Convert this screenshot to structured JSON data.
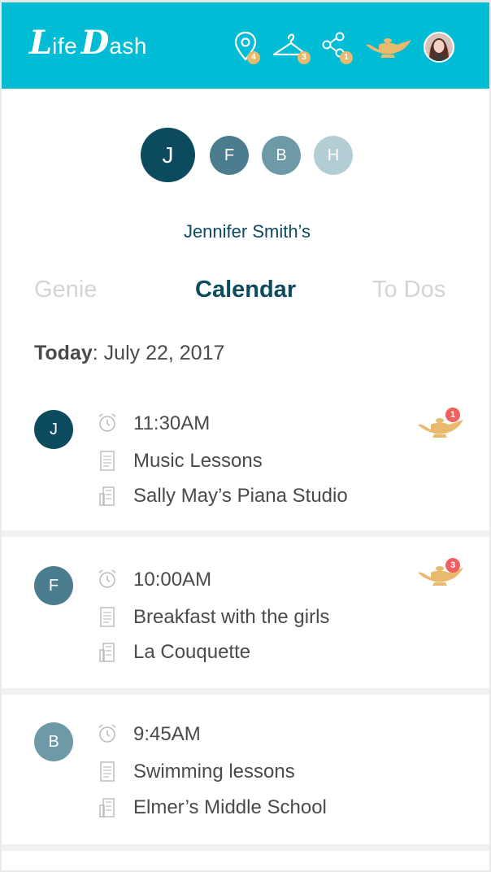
{
  "app": {
    "logo_big_1": "L",
    "logo_small_1": "ife",
    "logo_big_2": "D",
    "logo_small_2": "ash",
    "brand_color": "#00bcd4"
  },
  "header": {
    "icons": [
      {
        "name": "location-pin-icon",
        "badge": "4"
      },
      {
        "name": "hanger-icon",
        "badge": "3"
      },
      {
        "name": "share-icon",
        "badge": "1"
      },
      {
        "name": "genie-lamp-icon"
      },
      {
        "name": "user-avatar"
      }
    ],
    "badge_color": "#e9b96e"
  },
  "family": {
    "members": [
      {
        "initial": "J",
        "color": "#0c4a5e",
        "selected": true
      },
      {
        "initial": "F",
        "color": "#4b7d8e"
      },
      {
        "initial": "B",
        "color": "#6e9aa7"
      },
      {
        "initial": "H",
        "color": "#b3cdd4"
      }
    ],
    "owner_label": "Jennifer Smith’s"
  },
  "tabs": [
    {
      "label": "Genie",
      "active": false
    },
    {
      "label": "Calendar",
      "active": true
    },
    {
      "label": "To Dos",
      "active": false
    }
  ],
  "today": {
    "label": "Today",
    "sep": ": ",
    "date": "July 22, 2017"
  },
  "events": [
    {
      "initial": "J",
      "color": "#0c4a5e",
      "time": "11:30AM",
      "title": "Music Lessons",
      "place": "Sally May’s Piana Studio",
      "lamp_badge": "1"
    },
    {
      "initial": "F",
      "color": "#4b7d8e",
      "time": "10:00AM",
      "title": "Breakfast with the girls",
      "place": "La Couquette",
      "lamp_badge": "3"
    },
    {
      "initial": "B",
      "color": "#6e9aa7",
      "time": "9:45AM",
      "title": "Swimming lessons",
      "place": "Elmer’s Middle School"
    }
  ]
}
